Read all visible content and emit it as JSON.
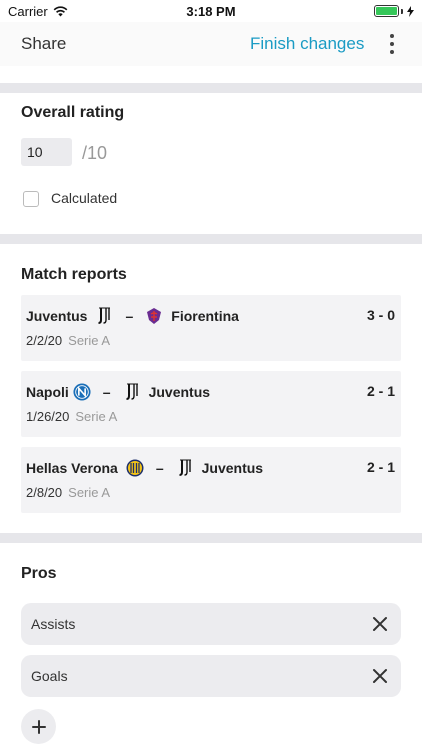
{
  "status_bar": {
    "carrier": "Carrier",
    "time": "3:18 PM",
    "wifi_icon": "wifi-icon",
    "battery_icon": "battery-icon",
    "battery_level": 1.0
  },
  "nav": {
    "share_label": "Share",
    "finish_label": "Finish changes",
    "more_icon": "vertical-ellipsis-icon",
    "accent_color": "#1a9bc4"
  },
  "rating": {
    "title": "Overall rating",
    "value": "10",
    "max_label": "/10",
    "calculated_label": "Calculated",
    "calculated_checked": false
  },
  "match_reports": {
    "title": "Match reports",
    "items": [
      {
        "home": "Juventus",
        "home_logo": "juventus-logo",
        "away": "Fiorentina",
        "away_logo": "fiorentina-logo",
        "score": "3 - 0",
        "date": "2/2/20",
        "league": "Serie A"
      },
      {
        "home": "Napoli",
        "home_logo": "napoli-logo",
        "away": "Juventus",
        "away_logo": "juventus-logo",
        "score": "2 - 1",
        "date": "1/26/20",
        "league": "Serie A"
      },
      {
        "home": "Hellas Verona",
        "home_logo": "hellas-verona-logo",
        "away": "Juventus",
        "away_logo": "juventus-logo",
        "score": "2 - 1",
        "date": "2/8/20",
        "league": "Serie A"
      }
    ],
    "separator": "–"
  },
  "pros": {
    "title": "Pros",
    "items": [
      {
        "label": "Assists",
        "remove_icon": "close-icon"
      },
      {
        "label": "Goals",
        "remove_icon": "close-icon"
      }
    ],
    "add_icon": "plus-icon"
  }
}
